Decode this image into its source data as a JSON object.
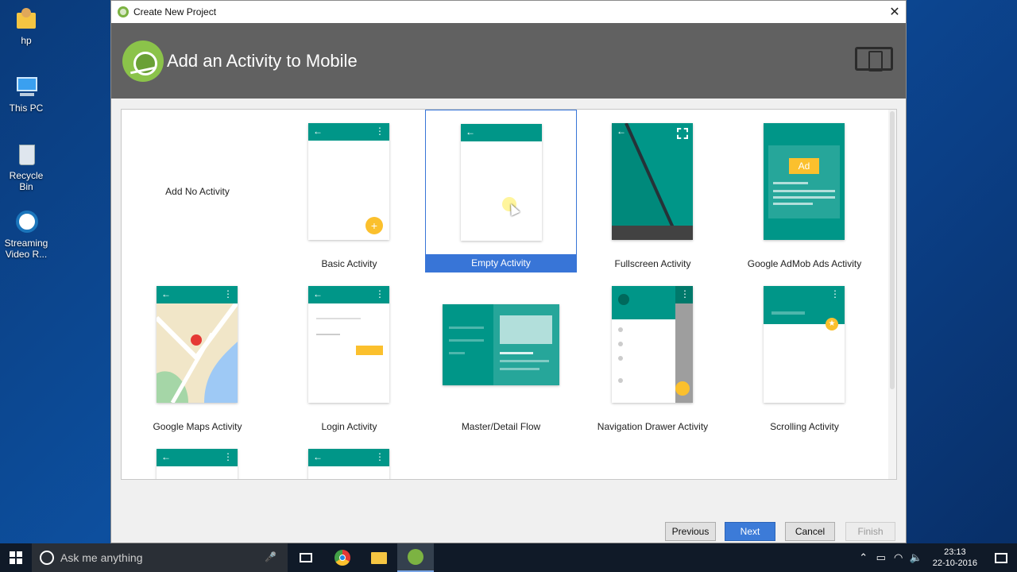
{
  "desktop": {
    "icons": [
      {
        "label": "hp"
      },
      {
        "label": "This PC"
      },
      {
        "label": "Recycle Bin"
      },
      {
        "label": "Streaming Video R..."
      }
    ]
  },
  "window": {
    "title": "Create New Project",
    "close_glyph": "✕",
    "banner_title": "Add an Activity to Mobile"
  },
  "activities": [
    {
      "label": "Add No Activity"
    },
    {
      "label": "Basic Activity"
    },
    {
      "label": "Empty Activity",
      "selected": true
    },
    {
      "label": "Fullscreen Activity"
    },
    {
      "label": "Google AdMob Ads Activity",
      "ad_badge": "Ad"
    },
    {
      "label": "Google Maps Activity"
    },
    {
      "label": "Login Activity"
    },
    {
      "label": "Master/Detail Flow"
    },
    {
      "label": "Navigation Drawer Activity"
    },
    {
      "label": "Scrolling Activity"
    }
  ],
  "buttons": {
    "previous": "Previous",
    "next": "Next",
    "cancel": "Cancel",
    "finish": "Finish"
  },
  "taskbar": {
    "search_placeholder": "Ask me anything",
    "time": "23:13",
    "date": "22-10-2016"
  },
  "colors": {
    "teal": "#009688",
    "accent_yellow": "#fbc02d",
    "selection_blue": "#3875d7",
    "banner_gray": "#616161"
  }
}
